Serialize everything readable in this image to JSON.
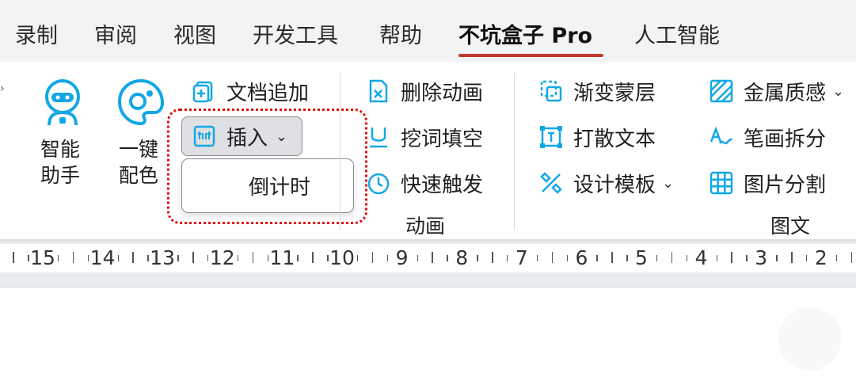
{
  "tabs": [
    {
      "label": "录制"
    },
    {
      "label": "审阅"
    },
    {
      "label": "视图"
    },
    {
      "label": "开发工具"
    },
    {
      "label": "帮助"
    },
    {
      "label": "不坑盒子 Pro",
      "active": true
    },
    {
      "label": "人工智能"
    }
  ],
  "ribbon": {
    "assistant_label": "智能\n助手",
    "assistant_line1": "智能",
    "assistant_line2": "助手",
    "color_line1": "一键",
    "color_line2": "配色",
    "doc_append": "文档追加",
    "insert": "插入",
    "insert_menu": {
      "items": [
        "倒计时"
      ]
    },
    "delete_animation": "删除动画",
    "cloze": "挖词填空",
    "quick_trigger": "快速触发",
    "animation_group": "动画",
    "gradient_mask": "渐变蒙层",
    "scatter_text": "打散文本",
    "design_template": "设计模板",
    "metal_texture": "金属质感",
    "stroke_split": "笔画拆分",
    "image_split": "图片分割",
    "graphic_group": "图文"
  },
  "ruler": {
    "labels": [
      "15",
      "14",
      "13",
      "12",
      "11",
      "10",
      "9",
      "8",
      "7",
      "6",
      "5",
      "4",
      "3",
      "2"
    ]
  },
  "colors": {
    "accent_underline": "#c0392b",
    "icon_cyan": "#12a7e6",
    "highlight": "#e01010"
  }
}
